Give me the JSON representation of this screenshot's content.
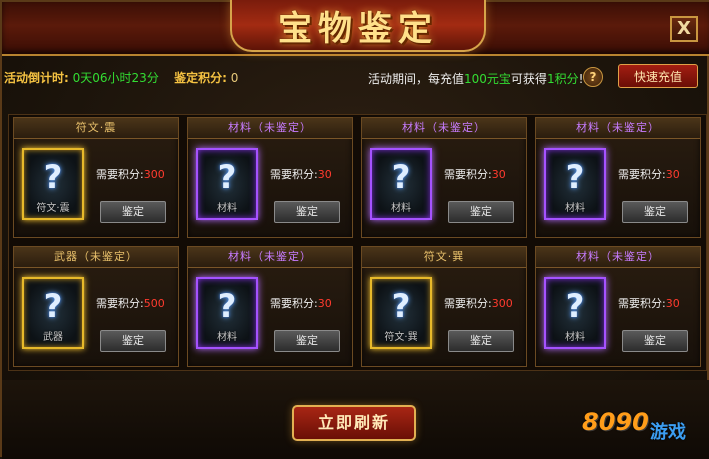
{
  "window": {
    "title": "宝物鉴定",
    "close_label": "X"
  },
  "info": {
    "countdown_label": "活动倒计时:",
    "countdown_value": "0天06小时23分",
    "points_label": "鉴定积分:",
    "points_value": "0",
    "promo_prefix": "活动期间，每充值",
    "promo_amount": "100元宝",
    "promo_middle": "可获得",
    "promo_reward": "1积分",
    "promo_suffix": "!",
    "help_label": "?",
    "recharge_label": "快速充值"
  },
  "cards": [
    {
      "title": "符文·震",
      "rarity": "gold",
      "slot_name": "符文·震",
      "req_label": "需要积分:",
      "req_points": "300",
      "button": "鉴定"
    },
    {
      "title": "材料（未鉴定）",
      "rarity": "purple",
      "slot_name": "材料",
      "req_label": "需要积分:",
      "req_points": "30",
      "button": "鉴定"
    },
    {
      "title": "材料（未鉴定）",
      "rarity": "purple",
      "slot_name": "材料",
      "req_label": "需要积分:",
      "req_points": "30",
      "button": "鉴定"
    },
    {
      "title": "材料（未鉴定）",
      "rarity": "purple",
      "slot_name": "材料",
      "req_label": "需要积分:",
      "req_points": "30",
      "button": "鉴定"
    },
    {
      "title": "武器（未鉴定）",
      "rarity": "gold",
      "slot_name": "武器",
      "req_label": "需要积分:",
      "req_points": "500",
      "button": "鉴定"
    },
    {
      "title": "材料（未鉴定）",
      "rarity": "purple",
      "slot_name": "材料",
      "req_label": "需要积分:",
      "req_points": "30",
      "button": "鉴定"
    },
    {
      "title": "符文·巽",
      "rarity": "gold",
      "slot_name": "符文·巽",
      "req_label": "需要积分:",
      "req_points": "300",
      "button": "鉴定"
    },
    {
      "title": "材料（未鉴定）",
      "rarity": "purple",
      "slot_name": "材料",
      "req_label": "需要积分:",
      "req_points": "30",
      "button": "鉴定"
    }
  ],
  "slot_glyph": "?",
  "refresh_label": "立即刷新",
  "watermark": {
    "number": "8090",
    "word": "游戏"
  },
  "colors": {
    "gold_border": "#e7b92a",
    "purple_border": "#a552ff",
    "points_red": "#ff3b2f",
    "green_value": "#33dd33"
  }
}
